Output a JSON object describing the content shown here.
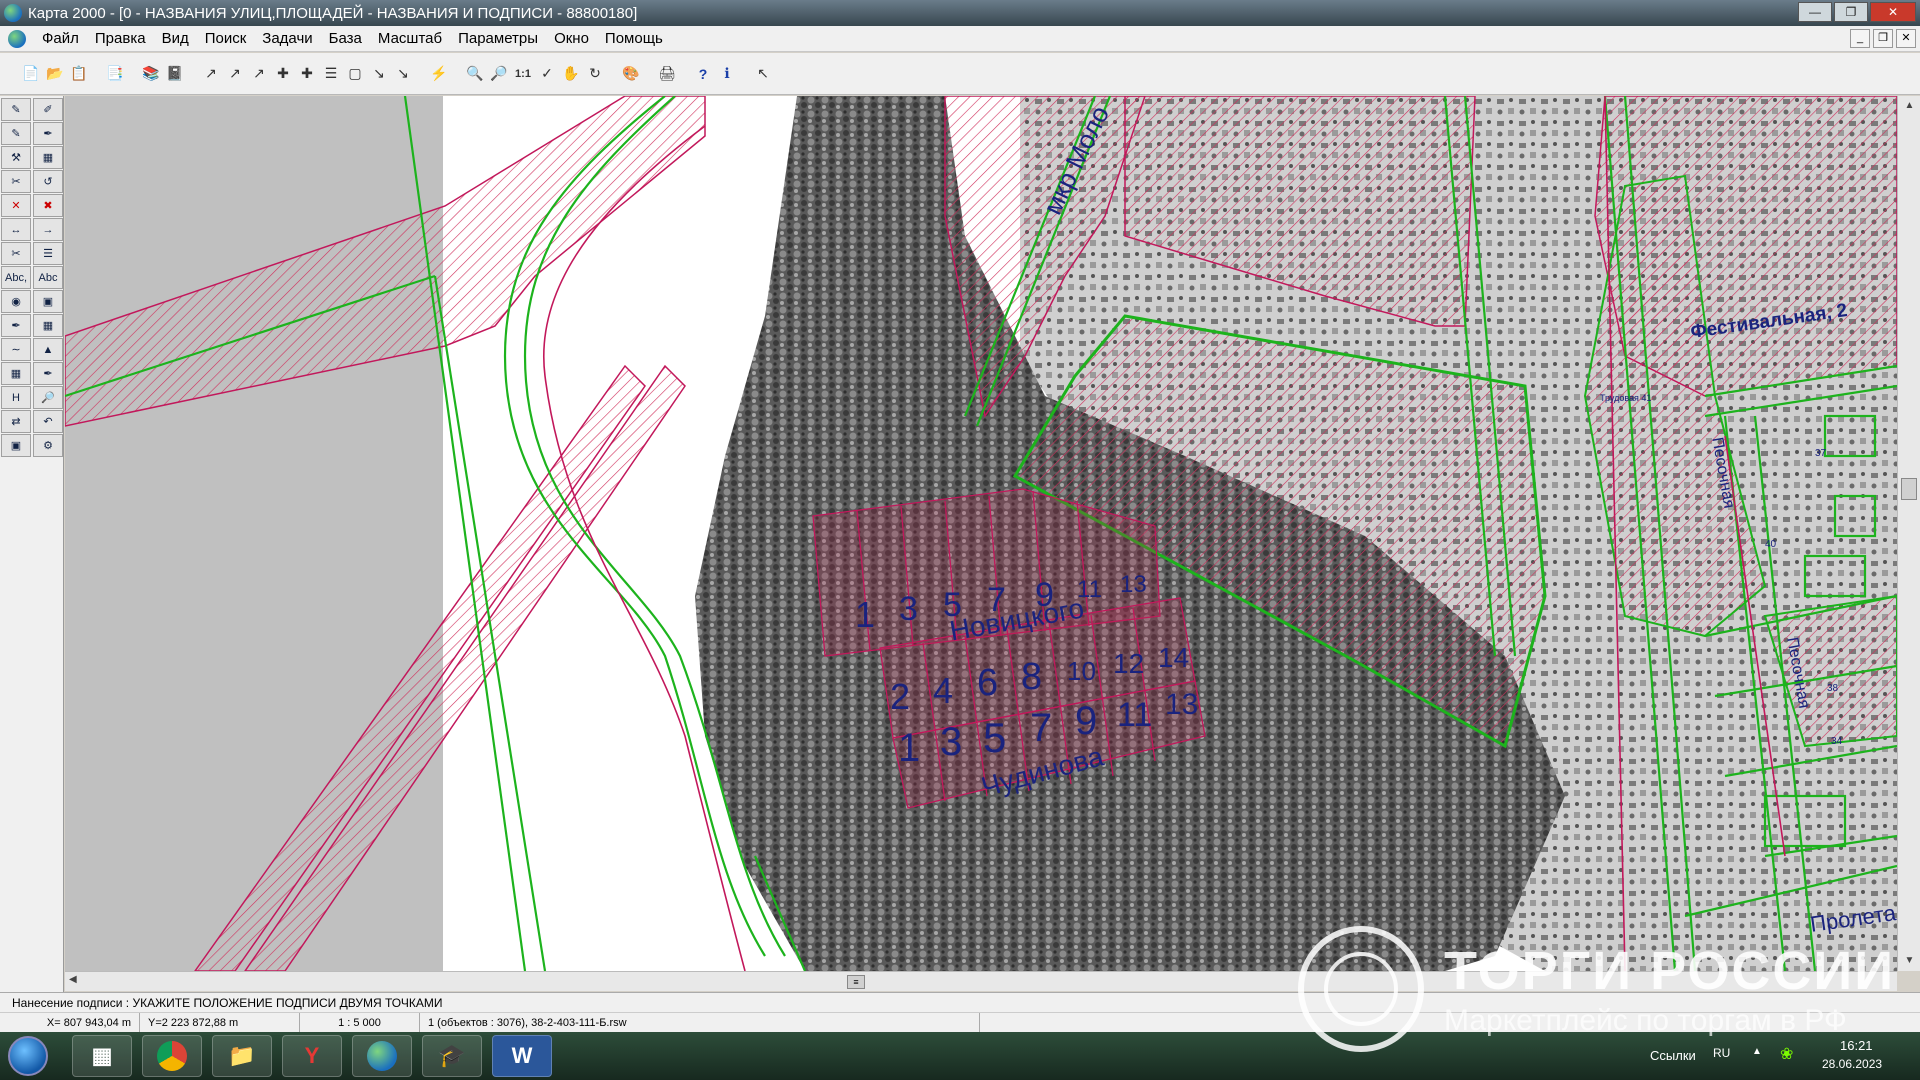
{
  "window": {
    "title": "Карта 2000 - [0 - НАЗВАНИЯ УЛИЦ,ПЛОЩАДЕЙ - НАЗВАНИЯ И ПОДПИСИ - 88800180]"
  },
  "menu": {
    "items": [
      "Файл",
      "Правка",
      "Вид",
      "Поиск",
      "Задачи",
      "База",
      "Масштаб",
      "Параметры",
      "Окно",
      "Помощь"
    ]
  },
  "toolbar": {
    "scale_one_to_one": "1:1"
  },
  "palette": {
    "abc1": "Abc,",
    "abc2": "Abc",
    "h": "H"
  },
  "map": {
    "labels": {
      "mkr": "мкр Моло",
      "festivalnaya": "Фестивальная, 2",
      "novitskogo": "Новицкого",
      "chudinova": "Чудинова",
      "pesochnaya1": "Песочная",
      "pesochnaya2": "Песочная",
      "proleta": "Пролета",
      "trudovaya": "Трудовая 41",
      "n40": "40",
      "n38": "38",
      "n34": "34",
      "n37": "37"
    },
    "row1_numbers": [
      "1",
      "3",
      "5",
      "7",
      "9",
      "11",
      "13"
    ],
    "row2_numbers": [
      "2",
      "4",
      "6",
      "8",
      "10",
      "12",
      "14"
    ],
    "row3_numbers": [
      "1",
      "3",
      "5",
      "7",
      "9",
      "11",
      "13"
    ]
  },
  "status": {
    "message": "Нанесение подписи : УКАЖИТЕ ПОЛОЖЕНИЕ ПОДПИСИ ДВУМЯ ТОЧКАМИ",
    "x": "X=  807 943,04 m",
    "y": "Y=2 223 872,88 m",
    "scale": "1 : 5 000",
    "objects": "1   (объектов : 3076), 38-2-403-111-Б.rsw"
  },
  "watermark": {
    "title": "ТОРГИ РОССИИ",
    "subtitle": "Маркетплейс по торгам в РФ"
  },
  "taskbar": {
    "links": "Ссылки",
    "lang": "RU",
    "time": "16:21",
    "date": "28.06.2023",
    "yandex": "Y",
    "word": "W"
  },
  "colors": {
    "parcel_line": "#c2185b",
    "boundary_green": "#1db31d",
    "label_blue": "#1a237e",
    "gray_area": "#c0c0c0"
  }
}
